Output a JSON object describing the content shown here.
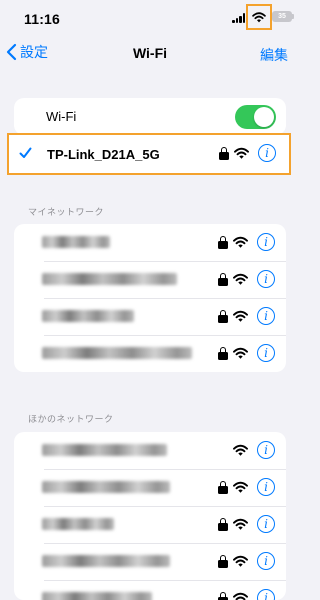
{
  "status_bar": {
    "time": "11:16",
    "battery": "35"
  },
  "nav": {
    "back_label": "設定",
    "title": "Wi-Fi",
    "edit_label": "編集"
  },
  "wifi_toggle": {
    "label": "Wi-Fi",
    "on": true
  },
  "connected_network": {
    "name": "TP-Link_D21A_5G",
    "secured": true
  },
  "my_networks": {
    "header": "マイネットワーク",
    "count": 4
  },
  "other_networks": {
    "header": "ほかのネットワーク",
    "count": 5,
    "secured": [
      false,
      true,
      true,
      true,
      true
    ]
  },
  "colors": {
    "accent": "#007aff",
    "toggle_on": "#34c759",
    "highlight": "#f4a22d",
    "background": "#f2f2f7"
  },
  "icons": [
    "wifi-icon",
    "lock-icon",
    "info-icon",
    "checkmark-icon",
    "chevron-left-icon",
    "signal-icon",
    "battery-icon"
  ]
}
